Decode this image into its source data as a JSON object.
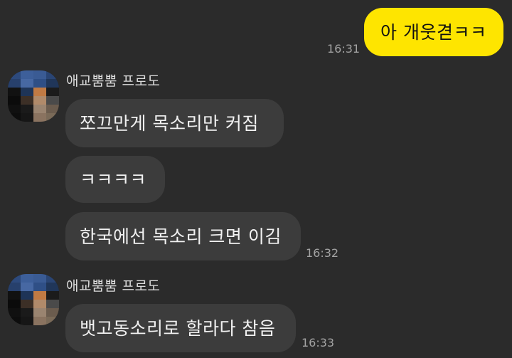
{
  "messages": {
    "m1": {
      "text": "아 개웃겯ㅋㅋ",
      "time": "16:31"
    },
    "group1": {
      "sender": "애교뿜뿜 프로도",
      "m2": {
        "text": "쪼끄만게  목소리만 커짐"
      },
      "m3": {
        "text": "ㅋㅋㅋㅋ"
      },
      "m4": {
        "text": "한국에선 목소리 크면 이김",
        "time": "16:32"
      }
    },
    "group2": {
      "sender": "애교뿜뿜 프로도",
      "m5": {
        "text": "뱃고동소리로 할라다 참음",
        "time": "16:33"
      }
    }
  },
  "colors": {
    "background": "#2b2b2b",
    "my_bubble": "#fee500",
    "their_bubble": "#3c3c3c"
  }
}
